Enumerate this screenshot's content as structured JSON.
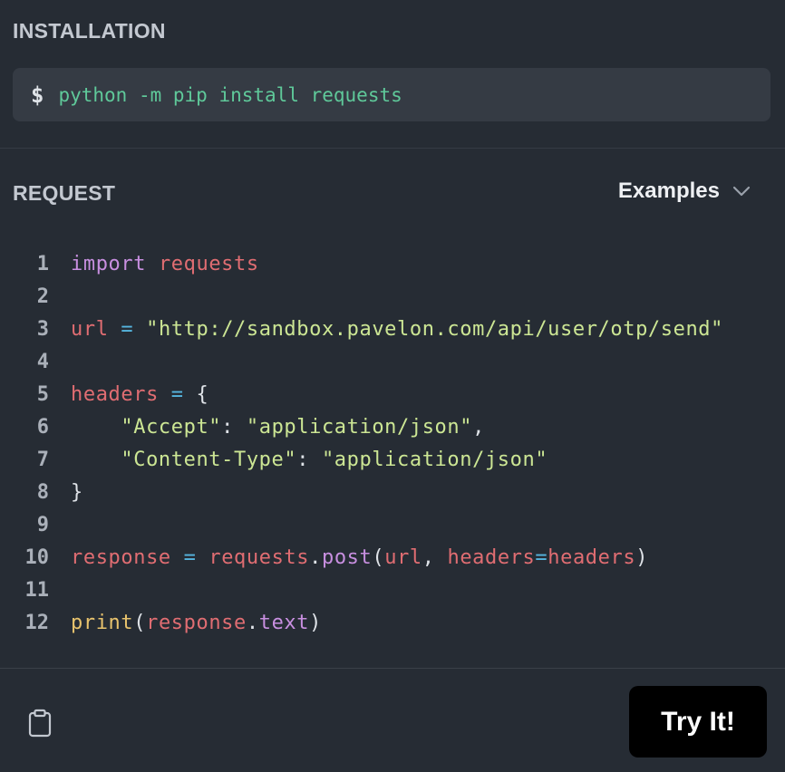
{
  "installation": {
    "label": "INSTALLATION",
    "prompt": "$",
    "command": "python -m pip install requests"
  },
  "request": {
    "label": "REQUEST",
    "examples_label": "Examples"
  },
  "code": {
    "line_numbers": [
      "1",
      "2",
      "3",
      "4",
      "5",
      "6",
      "7",
      "8",
      "9",
      "10",
      "11",
      "12"
    ],
    "l1": {
      "kw": "import",
      "mod": "requests"
    },
    "l3": {
      "var": "url",
      "op": "=",
      "str": "\"http://sandbox.pavelon.com/api/user/otp/send\""
    },
    "l5": {
      "var": "headers",
      "op": "=",
      "brace": "{"
    },
    "l6": {
      "key": "\"Accept\"",
      "colon": ":",
      "val": "\"application/json\"",
      "comma": ","
    },
    "l7": {
      "key": "\"Content-Type\"",
      "colon": ":",
      "val": "\"application/json\""
    },
    "l8": {
      "brace": "}"
    },
    "l10": {
      "var": "response",
      "op": "=",
      "obj": "requests",
      "dot": ".",
      "fn": "post",
      "lp": "(",
      "arg1": "url",
      "comma": ",",
      "kwname": "headers",
      "eq": "=",
      "kwval": "headers",
      "rp": ")"
    },
    "l12": {
      "fn": "print",
      "lp": "(",
      "obj": "response",
      "dot": ".",
      "attr": "text",
      "rp": ")"
    }
  },
  "footer": {
    "try_label": "Try It!"
  },
  "icons": {
    "clipboard": "clipboard-icon",
    "chevron": "chevron-down-icon"
  },
  "colors": {
    "background": "#262c34",
    "panel": "#353b44",
    "command": "#5fc99a",
    "keyword": "#c88fe0",
    "variable": "#e06d72",
    "operator": "#56b6e0",
    "string": "#cce694",
    "builtin": "#e8c36d",
    "button": "#000000"
  }
}
